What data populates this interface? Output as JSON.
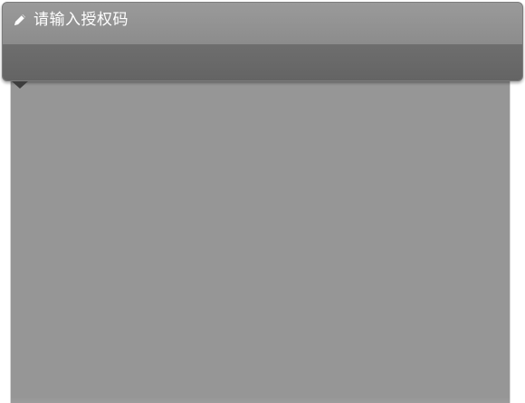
{
  "dialog": {
    "title": "请输入授权码",
    "title_icon": "pencil-icon"
  },
  "colors": {
    "header_bg": "#909090",
    "toolbar_band": "#666666",
    "panel_bg": "#969696",
    "title_text": "#ffffff"
  }
}
